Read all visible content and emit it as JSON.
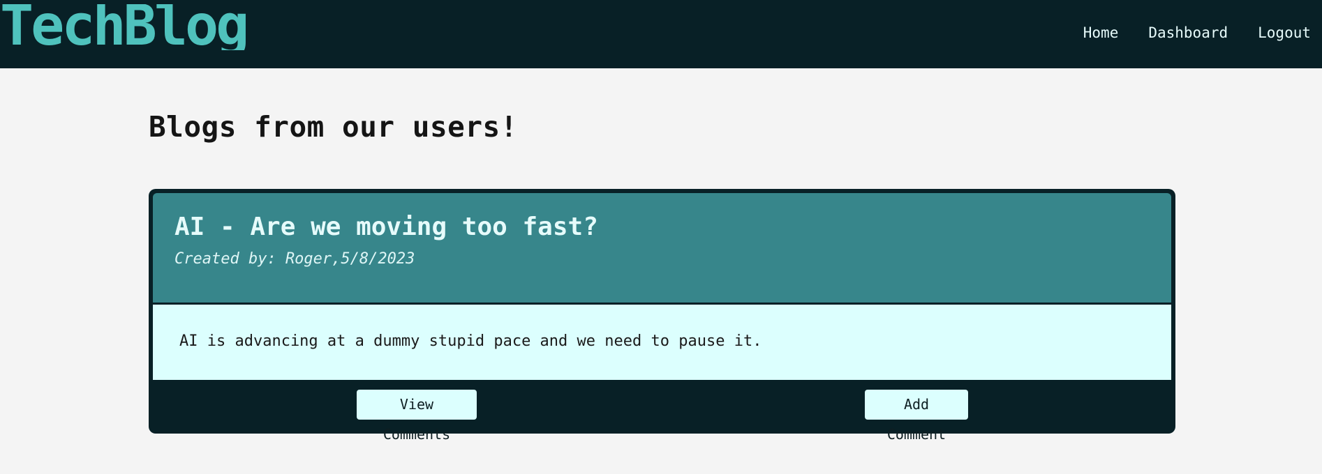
{
  "header": {
    "logo_text": "TechBlog",
    "nav": [
      {
        "label": "Home"
      },
      {
        "label": "Dashboard"
      },
      {
        "label": "Logout"
      }
    ]
  },
  "main": {
    "title": "Blogs from our users!",
    "posts": [
      {
        "title": "AI - Are we moving too fast?",
        "meta": "Created by: Roger,5/8/2023",
        "body": "AI is advancing at a dummy stupid pace and we need to pause it.",
        "view_label": "View Comments",
        "add_label": "Add Comment"
      }
    ]
  },
  "colors": {
    "header_bg": "#082026",
    "logo": "#4fc2bd",
    "card_head": "#37868b",
    "card_body": "#dcfffe",
    "page_bg": "#f4f4f4"
  }
}
